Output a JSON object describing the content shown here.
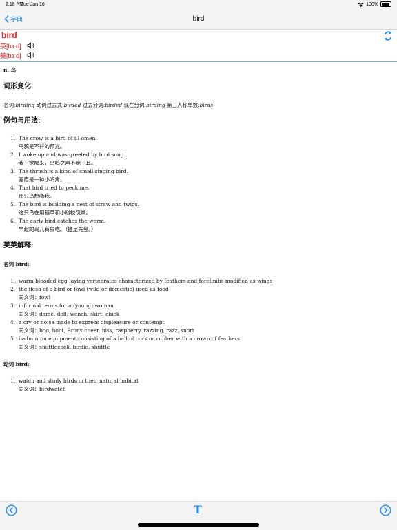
{
  "status": {
    "time": "2:18 PM",
    "date": "Tue Jan 16",
    "battery": "100%"
  },
  "nav": {
    "back_label": "字典",
    "title": "bird"
  },
  "entry": {
    "word": "bird",
    "uk": "英[bɜːd]",
    "us": "美[bɜːd]",
    "pos": "n. 鸟"
  },
  "sections": {
    "inflections_title": "词形变化:",
    "examples_title": "例句与用法:",
    "definitions_title": "英英解释:"
  },
  "inflections": [
    {
      "label": "名词:",
      "form": "birding"
    },
    {
      "label": " 动词过去式:",
      "form": "birded"
    },
    {
      "label": " 过去分词:",
      "form": "birded"
    },
    {
      "label": " 现在分词:",
      "form": "birding"
    },
    {
      "label": " 第三人称单数:",
      "form": "birds"
    }
  ],
  "examples": [
    {
      "en": "The crow is a bird of ill omen.",
      "cn": "乌鸦是不祥的预兆。"
    },
    {
      "en": "I woke up and was greeted by bird song.",
      "cn": "我一觉醒来，鸟鸣之声不绝于耳。"
    },
    {
      "en": "The thrush is a kind of small singing bird.",
      "cn": "画眉是一种小鸣禽。"
    },
    {
      "en": "That bird tried to peck me.",
      "cn": "那只鸟想啄我。"
    },
    {
      "en": "The bird is building a nest of straw and twigs.",
      "cn": "这只鸟在用稻草和小树枝筑巢。"
    },
    {
      "en": "The early bird catches the worm.",
      "cn": "早起的鸟儿有虫吃。（捷足先登。）"
    }
  ],
  "noun_heading": "名词 bird:",
  "noun_defs": [
    {
      "def": "warm-blooded egg-laying vertebrates characterized by feathers and forelimbs modified as wings",
      "syn": ""
    },
    {
      "def": "the flesh of a bird or fowl (wild or domestic) used as food",
      "syn": "同义词：fowl"
    },
    {
      "def": "informal terms for a (young) woman",
      "syn": "同义词：dame, doll, wench, skirt, chick"
    },
    {
      "def": "a cry or noise made to express displeasure or contempt",
      "syn": "同义词：boo, hoot, Bronx cheer, hiss, raspberry, razzing, razz, snort"
    },
    {
      "def": "badminton equipment consisting of a ball of cork or rubber with a crown of feathers",
      "syn": "同义词：shuttlecock, birdie, shuttle"
    }
  ],
  "verb_heading": "动词 bird:",
  "verb_defs": [
    {
      "def": "watch and study birds in their natural habitat",
      "syn": "同义词：birdwatch"
    }
  ],
  "toolbar": {
    "font_label": "T"
  },
  "colors": {
    "accent": "#1a8cff",
    "word_red": "#e02020",
    "divider": "#5ac8fa"
  },
  "icons": [
    "wifi-icon",
    "battery-icon",
    "chevron-left-icon",
    "speaker-icon",
    "refresh-icon",
    "prev-circle-icon",
    "font-icon",
    "next-circle-icon"
  ]
}
